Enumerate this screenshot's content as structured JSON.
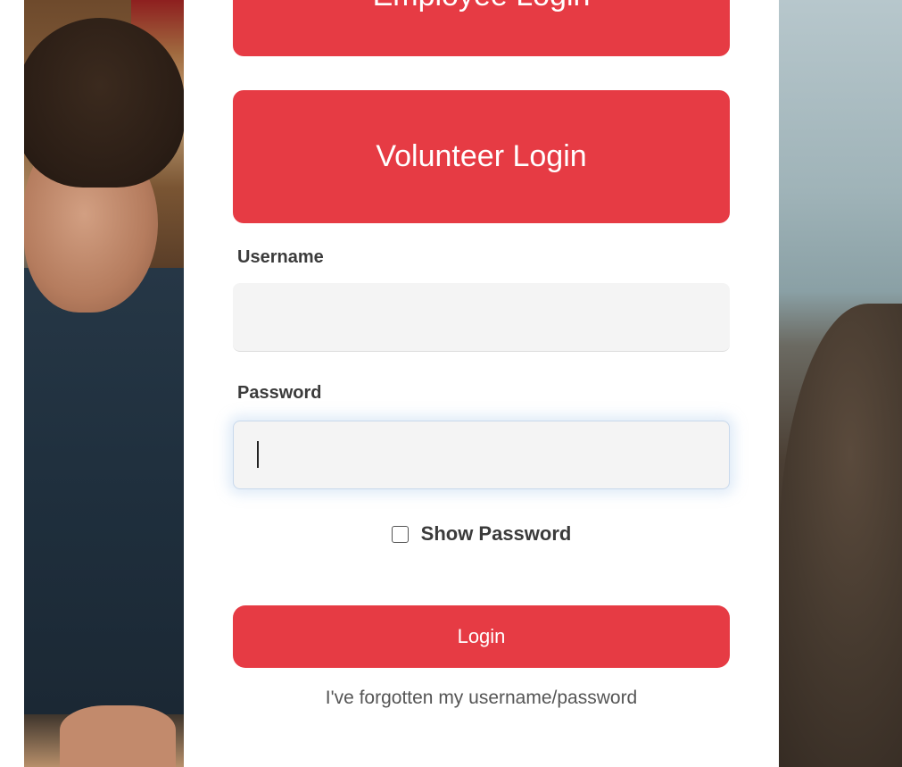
{
  "buttons": {
    "employee_login": "Employee Login",
    "volunteer_login": "Volunteer Login",
    "login": "Login"
  },
  "form": {
    "username_label": "Username",
    "username_value": "",
    "password_label": "Password",
    "password_value": "",
    "show_password_label": "Show Password",
    "show_password_checked": false
  },
  "links": {
    "forgot": "I've forgotten my username/password"
  },
  "colors": {
    "accent": "#e63b44",
    "input_bg": "#f4f4f4",
    "label_text": "#3b3b3b"
  }
}
